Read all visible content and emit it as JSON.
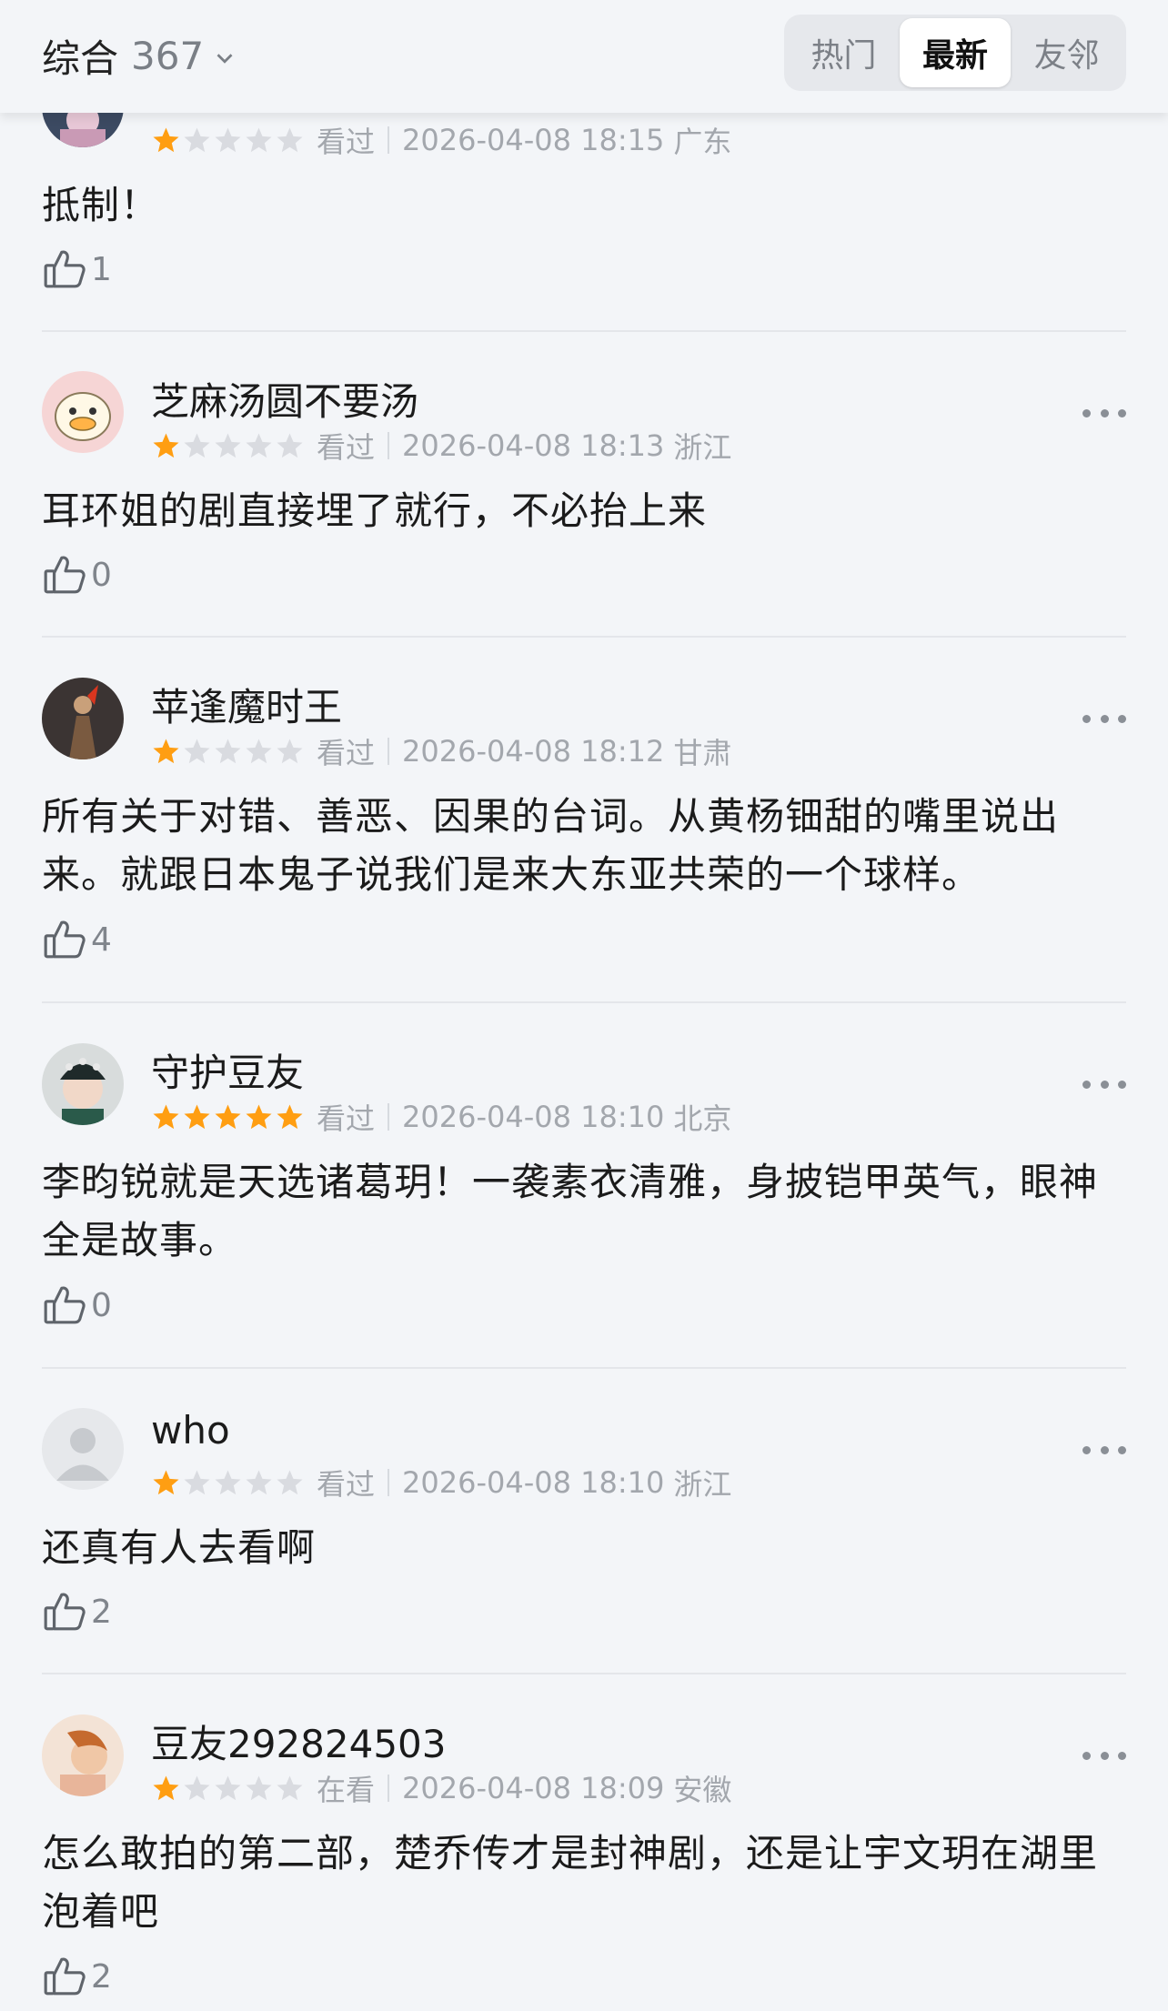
{
  "header": {
    "sort_label": "综合",
    "sort_count": "367",
    "tabs": [
      {
        "label": "热门",
        "active": false
      },
      {
        "label": "最新",
        "active": true
      },
      {
        "label": "友邻",
        "active": false
      }
    ]
  },
  "colors": {
    "star_filled": "#ff9e12",
    "star_empty": "#d9dbe0",
    "background": "#f3f5f8"
  },
  "comments": [
    {
      "username": "",
      "rating": 1,
      "status": "看过",
      "date": "2026-04-08 18:15",
      "location": "广东",
      "content": "抵制！",
      "likes": "1"
    },
    {
      "username": "芝麻汤圆不要汤",
      "rating": 1,
      "status": "看过",
      "date": "2026-04-08 18:13",
      "location": "浙江",
      "content": "耳环姐的剧直接埋了就行，不必抬上来",
      "likes": "0"
    },
    {
      "username": "苹逢魔时王",
      "rating": 1,
      "status": "看过",
      "date": "2026-04-08 18:12",
      "location": "甘肃",
      "content": "所有关于对错、善恶、因果的台词。从黄杨钿甜的嘴里说出来。就跟日本鬼子说我们是来大东亚共荣的一个球样。",
      "likes": "4"
    },
    {
      "username": "守护豆友",
      "rating": 5,
      "status": "看过",
      "date": "2026-04-08 18:10",
      "location": "北京",
      "content": "李昀锐就是天选诸葛玥！一袭素衣清雅，身披铠甲英气，眼神全是故事。",
      "likes": "0"
    },
    {
      "username": "who",
      "rating": 1,
      "status": "看过",
      "date": "2026-04-08 18:10",
      "location": "浙江",
      "content": "还真有人去看啊",
      "likes": "2"
    },
    {
      "username": "豆友292824503",
      "rating": 1,
      "status": "在看",
      "date": "2026-04-08 18:09",
      "location": "安徽",
      "content": "怎么敢拍的第二部，楚乔传才是封神剧，还是让宇文玥在湖里泡着吧",
      "likes": "2"
    }
  ]
}
